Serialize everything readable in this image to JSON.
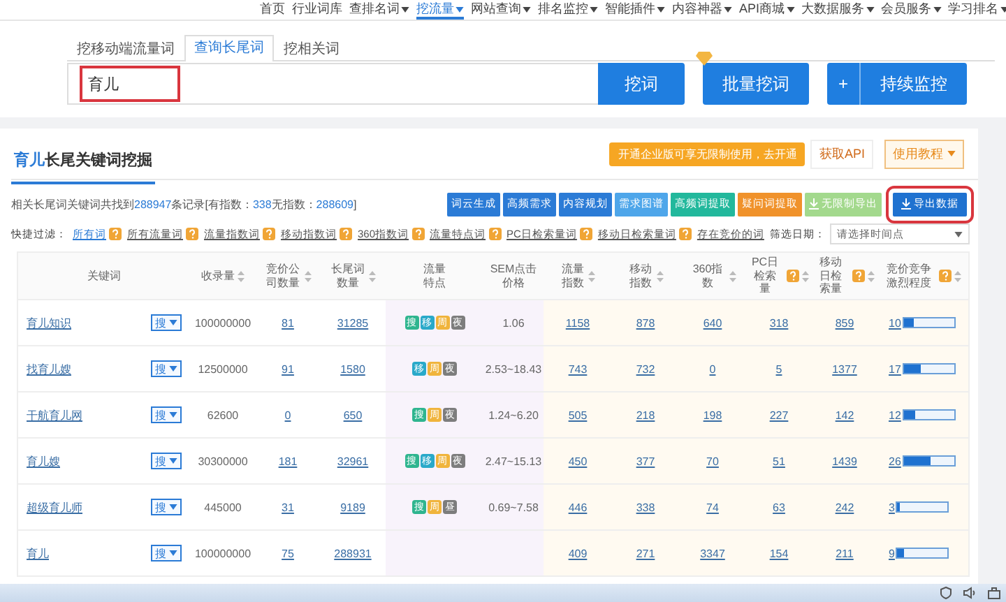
{
  "nav": {
    "items": [
      {
        "label": "首页",
        "selected": false,
        "dropdown": false
      },
      {
        "label": "行业词库",
        "selected": false,
        "dropdown": false
      },
      {
        "label": "查排名词",
        "selected": false,
        "dropdown": true
      },
      {
        "label": "挖流量",
        "selected": true,
        "dropdown": true
      },
      {
        "label": "网站查询",
        "selected": false,
        "dropdown": true
      },
      {
        "label": "排名监控",
        "selected": false,
        "dropdown": true
      },
      {
        "label": "智能插件",
        "selected": false,
        "dropdown": true
      },
      {
        "label": "内容神器",
        "selected": false,
        "dropdown": true
      },
      {
        "label": "API商城",
        "selected": false,
        "dropdown": true
      },
      {
        "label": "大数据服务",
        "selected": false,
        "dropdown": true
      },
      {
        "label": "会员服务",
        "selected": false,
        "dropdown": true
      },
      {
        "label": "学习排名",
        "selected": false,
        "dropdown": true
      }
    ]
  },
  "tabs": [
    {
      "label": "挖移动端流量词",
      "selected": false
    },
    {
      "label": "查询长尾词",
      "selected": true
    },
    {
      "label": "挖相关词",
      "selected": false
    }
  ],
  "search": {
    "value": "育儿",
    "highlighted": true,
    "buttons": [
      {
        "kind": "primary",
        "label": "挖词"
      },
      {
        "kind": "vip",
        "label": "批量挖词"
      },
      {
        "kind": "plus",
        "label": "持续监控",
        "icon": "+"
      }
    ]
  },
  "panel": {
    "title_keyword": "育儿",
    "title": "长尾关键词挖掘",
    "promo": "开通企业版可享无限制使用，去开通",
    "api_button": "获取API",
    "tutorial_button": "使用教程"
  },
  "summary": [
    {
      "kind": "text",
      "text": "相关长尾词关键词共找到"
    },
    {
      "kind": "number",
      "text": "288947"
    },
    {
      "kind": "text",
      "text": "条记录[有指数："
    },
    {
      "kind": "number",
      "text": "338"
    },
    {
      "kind": "text",
      "text": "无指数："
    },
    {
      "kind": "number",
      "text": "288609"
    },
    {
      "kind": "text",
      "text": "]"
    }
  ],
  "actions": [
    {
      "label": "词云生成",
      "color": "#2b7bd6",
      "icon": false,
      "highlighted": false
    },
    {
      "label": "高频需求",
      "color": "#2b7bd6",
      "icon": false,
      "highlighted": false
    },
    {
      "label": "内容规划",
      "color": "#2b7bd6",
      "icon": false,
      "highlighted": false
    },
    {
      "label": "需求图谱",
      "color": "#4ea6ea",
      "icon": false,
      "highlighted": false
    },
    {
      "label": "高频词提取",
      "color": "#22b89c",
      "icon": false,
      "highlighted": false
    },
    {
      "label": "疑问词提取",
      "color": "#f0922b",
      "icon": false,
      "highlighted": false
    },
    {
      "label": "无限制导出",
      "color": "#a3d98d",
      "icon": true,
      "highlighted": false
    },
    {
      "label": "导出数据",
      "color": "#1f72d0",
      "icon": true,
      "highlighted": true
    }
  ],
  "filters": {
    "label": "快捷过滤：",
    "items": [
      {
        "label": "所有词",
        "selected": true,
        "help": true
      },
      {
        "label": "所有流量词",
        "selected": false,
        "help": true
      },
      {
        "label": "流量指数词",
        "selected": false,
        "help": true
      },
      {
        "label": "移动指数词",
        "selected": false,
        "help": true
      },
      {
        "label": "360指数词",
        "selected": false,
        "help": true
      },
      {
        "label": "流量特点词",
        "selected": false,
        "help": true
      },
      {
        "label": "PC日检索量词",
        "selected": false,
        "help": true
      },
      {
        "label": "移动日检索量词",
        "selected": false,
        "help": true
      },
      {
        "label": "存在竞价的词",
        "selected": false,
        "help": false
      }
    ],
    "date_label": "筛选日期：",
    "date_placeholder": "请选择时间点"
  },
  "table": {
    "columns": [
      {
        "label": "关键词",
        "sortable": false,
        "help": false
      },
      {
        "label": "收录量",
        "sortable": true,
        "help": false
      },
      {
        "label": "竞价公司数量",
        "sortable": true,
        "help": false
      },
      {
        "label": "长尾词数量",
        "sortable": true,
        "help": false
      },
      {
        "label": "流量特点",
        "sortable": false,
        "help": false
      },
      {
        "label": "SEM点击价格",
        "sortable": false,
        "help": false
      },
      {
        "label": "流量指数",
        "sortable": true,
        "help": false
      },
      {
        "label": "移动指数",
        "sortable": true,
        "help": false
      },
      {
        "label": "360指数",
        "sortable": true,
        "help": false
      },
      {
        "label": "PC日检索量",
        "sortable": true,
        "help": true
      },
      {
        "label": "移动日检索量",
        "sortable": true,
        "help": true
      },
      {
        "label": "竞价竞争激烈程度",
        "sortable": true,
        "help": true
      }
    ],
    "rows": [
      {
        "keyword": "育儿知识",
        "engine": "搜",
        "included": "100000000",
        "bid_companies": "81",
        "longtail": "31285",
        "tags": [
          {
            "text": "搜",
            "color": "#2fb58f"
          },
          {
            "text": "移",
            "color": "#2aa9c9"
          },
          {
            "text": "周",
            "color": "#f0b43c"
          },
          {
            "text": "夜",
            "color": "#7d7d7d"
          }
        ],
        "sem": "1.06",
        "flow": "1158",
        "mobile": "878",
        "s360": "640",
        "pc_daily": "318",
        "mobile_daily": "859",
        "competition": "10",
        "level": 0.2
      },
      {
        "keyword": "找育儿嫂",
        "engine": "搜",
        "included": "12500000",
        "bid_companies": "91",
        "longtail": "1580",
        "tags": [
          {
            "text": "移",
            "color": "#2aa9c9"
          },
          {
            "text": "周",
            "color": "#f0b43c"
          },
          {
            "text": "夜",
            "color": "#7d7d7d"
          }
        ],
        "sem": "2.53~18.43",
        "flow": "743",
        "mobile": "732",
        "s360": "0",
        "pc_daily": "5",
        "mobile_daily": "1377",
        "competition": "17",
        "level": 0.34
      },
      {
        "keyword": "干航育儿网",
        "engine": "搜",
        "included": "62600",
        "bid_companies": "0",
        "longtail": "650",
        "tags": [
          {
            "text": "搜",
            "color": "#2fb58f"
          },
          {
            "text": "周",
            "color": "#f0b43c"
          },
          {
            "text": "夜",
            "color": "#7d7d7d"
          }
        ],
        "sem": "1.24~6.20",
        "flow": "505",
        "mobile": "218",
        "s360": "198",
        "pc_daily": "227",
        "mobile_daily": "142",
        "competition": "12",
        "level": 0.22
      },
      {
        "keyword": "育儿嫂",
        "engine": "搜",
        "included": "30300000",
        "bid_companies": "181",
        "longtail": "32961",
        "tags": [
          {
            "text": "搜",
            "color": "#2fb58f"
          },
          {
            "text": "移",
            "color": "#2aa9c9"
          },
          {
            "text": "周",
            "color": "#f0b43c"
          },
          {
            "text": "夜",
            "color": "#7d7d7d"
          }
        ],
        "sem": "2.47~15.13",
        "flow": "450",
        "mobile": "377",
        "s360": "70",
        "pc_daily": "51",
        "mobile_daily": "1439",
        "competition": "26",
        "level": 0.52
      },
      {
        "keyword": "超级育儿师",
        "engine": "搜",
        "included": "445000",
        "bid_companies": "31",
        "longtail": "9189",
        "tags": [
          {
            "text": "搜",
            "color": "#2fb58f"
          },
          {
            "text": "周",
            "color": "#f0b43c"
          },
          {
            "text": "昼",
            "color": "#7d7d7d"
          }
        ],
        "sem": "0.69~7.58",
        "flow": "446",
        "mobile": "338",
        "s360": "74",
        "pc_daily": "63",
        "mobile_daily": "242",
        "competition": "3",
        "level": 0.04
      },
      {
        "keyword": "育儿",
        "engine": "搜",
        "included": "100000000",
        "bid_companies": "75",
        "longtail": "288931",
        "tags": [],
        "sem": "",
        "flow": "409",
        "mobile": "271",
        "s360": "3347",
        "pc_daily": "154",
        "mobile_daily": "211",
        "competition": "9",
        "level": 0.14
      }
    ]
  }
}
